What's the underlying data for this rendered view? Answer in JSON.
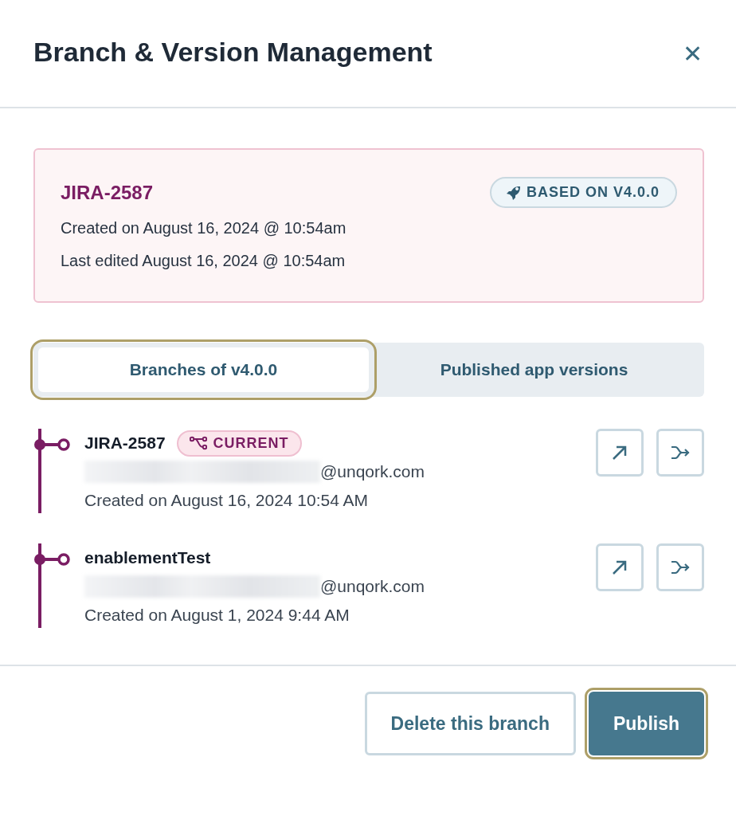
{
  "dialog": {
    "title": "Branch & Version Management",
    "close": "✕"
  },
  "branch_card": {
    "name": "JIRA-2587",
    "badge": "BASED ON V4.0.0",
    "created": "Created on August 16, 2024 @ 10:54am",
    "edited": "Last edited August 16, 2024 @ 10:54am"
  },
  "tabs": [
    {
      "label": "Branches of v4.0.0",
      "selected": true,
      "highlighted": true
    },
    {
      "label": "Published app versions",
      "selected": false,
      "highlighted": false
    }
  ],
  "branches": [
    {
      "name": "JIRA-2587",
      "badge": "CURRENT",
      "email": "@unqork.com",
      "created": "Created on August 16, 2024 10:54 AM"
    },
    {
      "name": "enablementTest",
      "email": "@unqork.com",
      "created": "Created on August 1, 2024 9:44 AM"
    }
  ],
  "footer": {
    "buttons": [
      {
        "label": "Delete this branch",
        "kind": "secondary",
        "highlighted": false
      },
      {
        "label": "Publish",
        "kind": "primary",
        "highlighted": true
      }
    ]
  }
}
